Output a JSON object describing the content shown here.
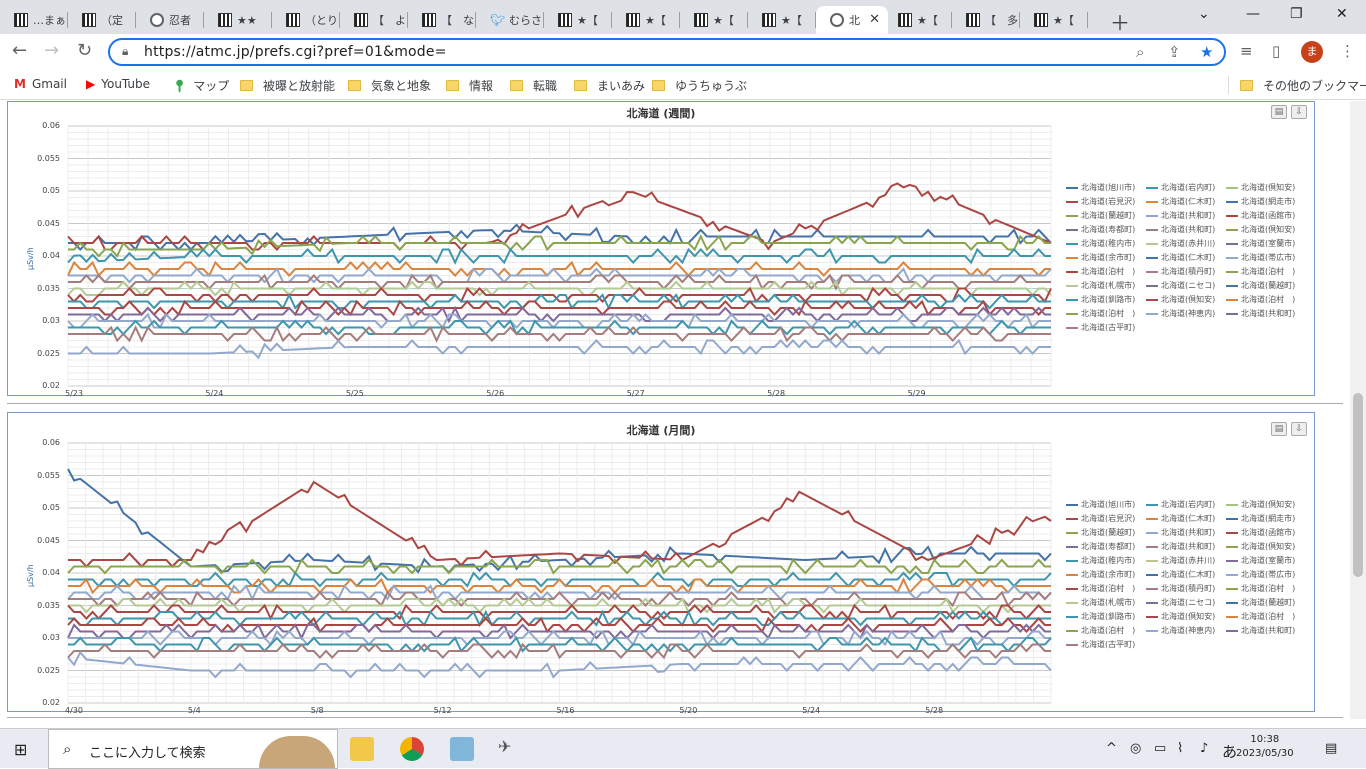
{
  "browser": {
    "tabs": [
      {
        "label": "…まぁ",
        "icon": "site-icon"
      },
      {
        "label": "（定",
        "icon": "site-icon"
      },
      {
        "label": "忍者",
        "icon": "globe-icon"
      },
      {
        "label": "★★",
        "icon": "site-icon"
      },
      {
        "label": "（とり",
        "icon": "site-icon"
      },
      {
        "label": "【　よ",
        "icon": "site-icon"
      },
      {
        "label": "【　な",
        "icon": "site-icon"
      },
      {
        "label": "むらさ",
        "icon": "twitter-icon"
      },
      {
        "label": "★【",
        "icon": "site-icon"
      },
      {
        "label": "★【",
        "icon": "site-icon"
      },
      {
        "label": "★【",
        "icon": "site-icon"
      },
      {
        "label": "★【",
        "icon": "site-icon"
      },
      {
        "label": "北",
        "icon": "globe-icon",
        "active": true
      },
      {
        "label": "★【",
        "icon": "site-icon"
      },
      {
        "label": "【　多",
        "icon": "site-icon"
      },
      {
        "label": "★【",
        "icon": "site-icon"
      }
    ],
    "url": "https://atmc.jp/prefs.cgi?pref=01&mode=",
    "profile_initial": "ま",
    "bookmarks": [
      {
        "label": "Gmail",
        "icon": "gmail-icon"
      },
      {
        "label": "YouTube",
        "icon": "youtube-icon"
      },
      {
        "label": "マップ",
        "icon": "maps-icon"
      },
      {
        "label": "被曝と放射能",
        "icon": "folder-icon"
      },
      {
        "label": "気象と地象",
        "icon": "folder-icon"
      },
      {
        "label": "情報",
        "icon": "folder-icon"
      },
      {
        "label": "転職",
        "icon": "folder-icon"
      },
      {
        "label": "まいあみ",
        "icon": "folder-icon"
      },
      {
        "label": "ゆうちゅうぶ",
        "icon": "folder-icon"
      }
    ],
    "other_bookmarks": "その他のブックマーク"
  },
  "legend": [
    {
      "name": "北海道(旭川市)",
      "color": "#4572a7"
    },
    {
      "name": "北海道(岩内町)",
      "color": "#3d96ae"
    },
    {
      "name": "北海道(倶知安)",
      "color": "#a8c47a"
    },
    {
      "name": "北海道(岩見沢)",
      "color": "#aa4643"
    },
    {
      "name": "北海道(仁木町)",
      "color": "#db843d"
    },
    {
      "name": "北海道(網走市)",
      "color": "#4572a7"
    },
    {
      "name": "北海道(蘭越町)",
      "color": "#89a54e"
    },
    {
      "name": "北海道(共和町)",
      "color": "#92a8cd"
    },
    {
      "name": "北海道(函館市)",
      "color": "#aa4643"
    },
    {
      "name": "北海道(寿都町)",
      "color": "#80699b"
    },
    {
      "name": "北海道(共和町)",
      "color": "#a47d7c"
    },
    {
      "name": "北海道(倶知安)",
      "color": "#89a54e"
    },
    {
      "name": "北海道(稚内市)",
      "color": "#3d96ae"
    },
    {
      "name": "北海道(赤井川)",
      "color": "#b5ca92"
    },
    {
      "name": "北海道(室蘭市)",
      "color": "#80699b"
    },
    {
      "name": "北海道(余市町)",
      "color": "#db843d"
    },
    {
      "name": "北海道(仁木町)",
      "color": "#4572a7"
    },
    {
      "name": "北海道(帯広市)",
      "color": "#92a8cd"
    },
    {
      "name": "北海道(泊村　)",
      "color": "#aa4643"
    },
    {
      "name": "北海道(積丹町)",
      "color": "#a47d7c"
    },
    {
      "name": "北海道(泊村　)",
      "color": "#89a54e"
    },
    {
      "name": "北海道(札幌市)",
      "color": "#b5ca92"
    },
    {
      "name": "北海道(ニセコ)",
      "color": "#80699b"
    },
    {
      "name": "北海道(蘭越町)",
      "color": "#4572a7"
    },
    {
      "name": "北海道(釧路市)",
      "color": "#3d96ae"
    },
    {
      "name": "北海道(倶知安)",
      "color": "#aa4643"
    },
    {
      "name": "北海道(泊村　)",
      "color": "#db843d"
    },
    {
      "name": "北海道(泊村　)",
      "color": "#89a54e"
    },
    {
      "name": "北海道(神恵内)",
      "color": "#92a8cd"
    },
    {
      "name": "北海道(共和町)",
      "color": "#80699b"
    },
    {
      "name": "北海道(古平町)",
      "color": "#a47d7c"
    }
  ],
  "chart_data": [
    {
      "type": "line",
      "title": "北海道 (週間)",
      "ylabel": "μSv/h",
      "ylim": [
        0.02,
        0.06
      ],
      "yticks": [
        "0.06",
        "0.055",
        "0.05",
        "0.045",
        "0.04",
        "0.035",
        "0.03",
        "0.025",
        "0.02"
      ],
      "xticks": [
        "5/23",
        "5/24",
        "5/25",
        "5/26",
        "5/27",
        "5/28",
        "5/29"
      ],
      "x_range": [
        "5/23",
        "5/29"
      ],
      "series": [
        {
          "name": "北海道(旭川市)",
          "values": [
            0.042,
            0.042,
            0.043,
            0.044,
            0.043,
            0.043,
            0.043,
            0.043
          ]
        },
        {
          "name": "北海道(岩見沢)",
          "values": [
            0.042,
            0.042,
            0.042,
            0.042,
            0.05,
            0.042,
            0.051,
            0.042
          ]
        },
        {
          "name": "北海道(蘭越町)",
          "values": [
            0.041,
            0.041,
            0.042,
            0.042,
            0.042,
            0.042,
            0.042,
            0.042
          ]
        },
        {
          "name": "北海道(稚内市)",
          "values": [
            0.039,
            0.04,
            0.04,
            0.04,
            0.04,
            0.04,
            0.04,
            0.04
          ]
        },
        {
          "name": "北海道(仁木町)",
          "values": [
            0.038,
            0.038,
            0.038,
            0.038,
            0.038,
            0.038,
            0.038,
            0.038
          ]
        },
        {
          "name": "北海道(帯広市)",
          "values": [
            0.037,
            0.037,
            0.037,
            0.037,
            0.037,
            0.037,
            0.037,
            0.037
          ]
        },
        {
          "name": "北海道(積丹町)",
          "values": [
            0.036,
            0.036,
            0.036,
            0.036,
            0.036,
            0.036,
            0.036,
            0.036
          ]
        },
        {
          "name": "北海道(札幌市)",
          "values": [
            0.035,
            0.035,
            0.035,
            0.035,
            0.035,
            0.035,
            0.035,
            0.035
          ]
        },
        {
          "name": "北海道(函館市)",
          "values": [
            0.034,
            0.034,
            0.034,
            0.034,
            0.034,
            0.034,
            0.034,
            0.034
          ]
        },
        {
          "name": "北海道(釧路市)",
          "values": [
            0.033,
            0.033,
            0.033,
            0.033,
            0.033,
            0.033,
            0.033,
            0.033
          ]
        },
        {
          "name": "北海道(泊村　)",
          "values": [
            0.032,
            0.032,
            0.032,
            0.032,
            0.032,
            0.032,
            0.032,
            0.032
          ]
        },
        {
          "name": "北海道(室蘭市)",
          "values": [
            0.031,
            0.031,
            0.031,
            0.031,
            0.031,
            0.031,
            0.031,
            0.031
          ]
        },
        {
          "name": "北海道(共和町)",
          "values": [
            0.03,
            0.03,
            0.03,
            0.03,
            0.03,
            0.03,
            0.03,
            0.03
          ]
        },
        {
          "name": "北海道(岩内町)",
          "values": [
            0.029,
            0.029,
            0.029,
            0.029,
            0.029,
            0.029,
            0.029,
            0.029
          ]
        },
        {
          "name": "北海道(古平町)",
          "values": [
            0.028,
            0.028,
            0.028,
            0.028,
            0.028,
            0.028,
            0.028,
            0.028
          ]
        },
        {
          "name": "北海道(共和町)",
          "values": [
            0.025,
            0.025,
            0.026,
            0.026,
            0.026,
            0.026,
            0.026,
            0.026
          ]
        }
      ]
    },
    {
      "type": "line",
      "title": "北海道 (月間)",
      "ylabel": "μSv/h",
      "ylim": [
        0.02,
        0.06
      ],
      "yticks": [
        "0.06",
        "0.055",
        "0.05",
        "0.045",
        "0.04",
        "0.035",
        "0.03",
        "0.025",
        "0.02"
      ],
      "xticks": [
        "4/30",
        "5/4",
        "5/8",
        "5/12",
        "5/16",
        "5/20",
        "5/24",
        "5/28"
      ],
      "x_range": [
        "4/30",
        "5/29"
      ],
      "series": [
        {
          "name": "北海道(旭川市)",
          "values": [
            0.056,
            0.041,
            0.042,
            0.041,
            0.042,
            0.043,
            0.042,
            0.043,
            0.043
          ]
        },
        {
          "name": "北海道(岩見沢)",
          "values": [
            0.042,
            0.042,
            0.054,
            0.042,
            0.043,
            0.042,
            0.052,
            0.042,
            0.049
          ]
        },
        {
          "name": "北海道(蘭越町)",
          "values": [
            0.041,
            0.041,
            0.041,
            0.041,
            0.041,
            0.041,
            0.041,
            0.041,
            0.041
          ]
        },
        {
          "name": "北海道(稚内市)",
          "values": [
            0.039,
            0.039,
            0.039,
            0.039,
            0.039,
            0.039,
            0.039,
            0.039,
            0.039
          ]
        },
        {
          "name": "北海道(仁木町)",
          "values": [
            0.038,
            0.038,
            0.038,
            0.038,
            0.038,
            0.038,
            0.038,
            0.038,
            0.038
          ]
        },
        {
          "name": "北海道(帯広市)",
          "values": [
            0.037,
            0.037,
            0.037,
            0.037,
            0.037,
            0.037,
            0.037,
            0.037,
            0.037
          ]
        },
        {
          "name": "北海道(積丹町)",
          "values": [
            0.036,
            0.036,
            0.036,
            0.036,
            0.036,
            0.036,
            0.036,
            0.036,
            0.036
          ]
        },
        {
          "name": "北海道(札幌市)",
          "values": [
            0.035,
            0.035,
            0.035,
            0.035,
            0.035,
            0.035,
            0.035,
            0.035,
            0.035
          ]
        },
        {
          "name": "北海道(函館市)",
          "values": [
            0.034,
            0.034,
            0.034,
            0.034,
            0.034,
            0.034,
            0.034,
            0.034,
            0.034
          ]
        },
        {
          "name": "北海道(釧路市)",
          "values": [
            0.033,
            0.033,
            0.033,
            0.033,
            0.033,
            0.033,
            0.033,
            0.033,
            0.033
          ]
        },
        {
          "name": "北海道(泊村　)",
          "values": [
            0.032,
            0.032,
            0.032,
            0.032,
            0.032,
            0.032,
            0.032,
            0.032,
            0.032
          ]
        },
        {
          "name": "北海道(室蘭市)",
          "values": [
            0.031,
            0.031,
            0.031,
            0.031,
            0.031,
            0.031,
            0.031,
            0.031,
            0.031
          ]
        },
        {
          "name": "北海道(共和町)",
          "values": [
            0.03,
            0.03,
            0.03,
            0.03,
            0.03,
            0.03,
            0.03,
            0.03,
            0.03
          ]
        },
        {
          "name": "北海道(岩内町)",
          "values": [
            0.029,
            0.029,
            0.029,
            0.029,
            0.029,
            0.029,
            0.029,
            0.029,
            0.029
          ]
        },
        {
          "name": "北海道(古平町)",
          "values": [
            0.028,
            0.028,
            0.028,
            0.028,
            0.028,
            0.028,
            0.028,
            0.028,
            0.028
          ]
        },
        {
          "name": "北海道(共和町)",
          "values": [
            0.027,
            0.025,
            0.025,
            0.025,
            0.025,
            0.026,
            0.026,
            0.026,
            0.026
          ]
        }
      ]
    }
  ],
  "taskbar": {
    "search_placeholder": "ここに入力して検索",
    "time": "10:38",
    "date": "2023/05/30",
    "ime": "あ"
  }
}
